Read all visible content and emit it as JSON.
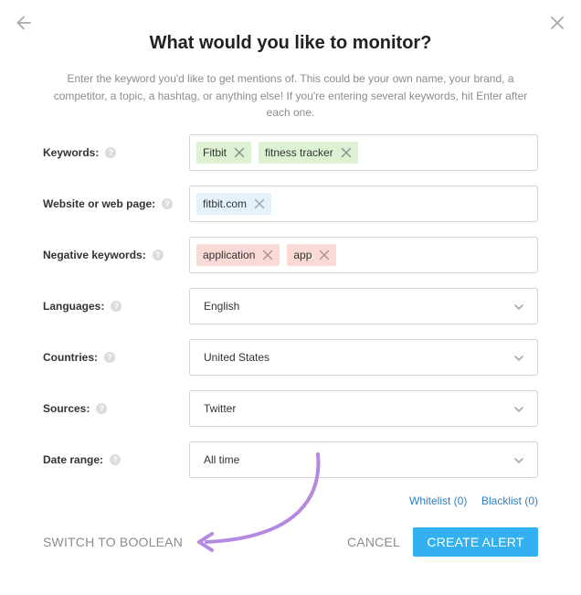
{
  "dialog": {
    "title": "What would you like to monitor?",
    "subtitle": "Enter the keyword you'd like to get mentions of. This could be your own name, your brand, a competitor, a topic, a hashtag, or anything else! If you're entering several keywords, hit Enter after each one."
  },
  "fields": {
    "keywords": {
      "label": "Keywords:",
      "tags": [
        "Fitbit",
        "fitness tracker"
      ]
    },
    "website": {
      "label": "Website or web page:",
      "tags": [
        "fitbit.com"
      ]
    },
    "negative": {
      "label": "Negative keywords:",
      "tags": [
        "application",
        "app"
      ]
    },
    "languages": {
      "label": "Languages:",
      "value": "English"
    },
    "countries": {
      "label": "Countries:",
      "value": "United States"
    },
    "sources": {
      "label": "Sources:",
      "value": "Twitter"
    },
    "date_range": {
      "label": "Date range:",
      "value": "All time"
    }
  },
  "help_glyph": "?",
  "links": {
    "whitelist": "Whitelist (0)",
    "blacklist": "Blacklist (0)"
  },
  "actions": {
    "switch": "SWITCH TO BOOLEAN",
    "cancel": "CANCEL",
    "create": "CREATE ALERT"
  },
  "colors": {
    "accent": "#33b0f0",
    "link": "#2d7fc1",
    "tag_green": "#dff1d3",
    "tag_blue": "#e6f2fb",
    "tag_red": "#f9dad7",
    "annotation_arrow": "#b48ae0"
  },
  "icons": {
    "back": "arrow-left-icon",
    "close": "close-icon",
    "help": "help-circle-icon",
    "remove": "x-icon",
    "dropdown": "chevron-down-icon"
  }
}
